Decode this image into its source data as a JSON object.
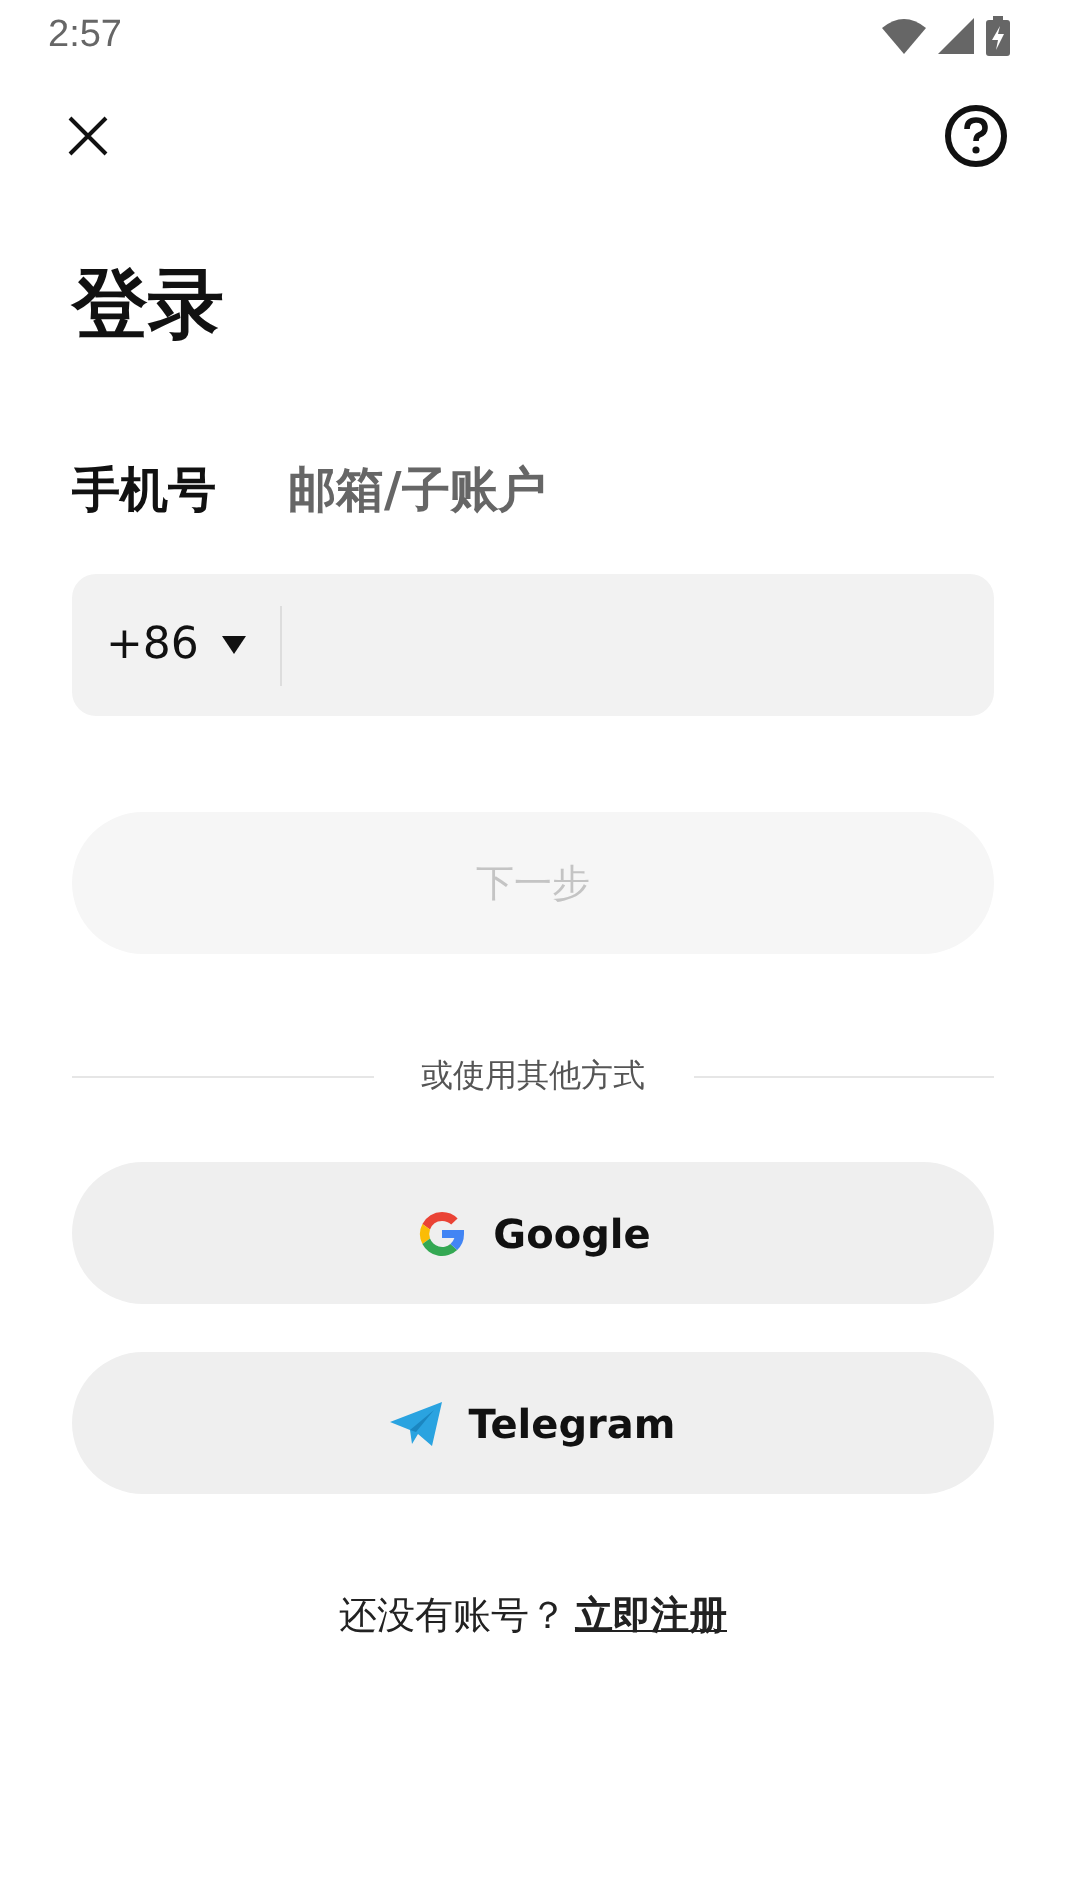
{
  "status_bar": {
    "time": "2:57"
  },
  "title": "登录",
  "tabs": [
    {
      "label": "手机号",
      "selected": true
    },
    {
      "label": "邮箱/子账户",
      "selected": false
    }
  ],
  "phone_field": {
    "country_code": "+86"
  },
  "next_button": {
    "label": "下一步",
    "disabled": true
  },
  "divider_text": "或使用其他方式",
  "social_buttons": [
    {
      "kind": "google",
      "label": "Google"
    },
    {
      "kind": "telegram",
      "label": "Telegram"
    }
  ],
  "footer": {
    "text": "还没有账号？",
    "link": "立即注册"
  }
}
